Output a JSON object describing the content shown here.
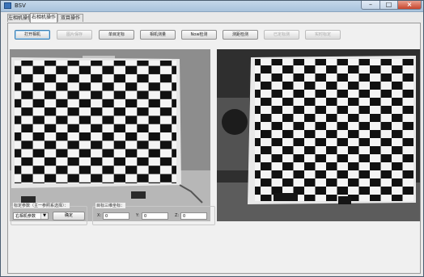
{
  "window": {
    "title": "BSV"
  },
  "window_controls": {
    "minimize": "–",
    "maximize": "□",
    "close": "×"
  },
  "tabs": [
    {
      "label": "左相机操作",
      "active": false
    },
    {
      "label": "右相机操作",
      "active": true
    },
    {
      "label": "双目操作",
      "active": false
    }
  ],
  "toolbar": [
    {
      "label": "打开相机",
      "enabled": true,
      "focused": true
    },
    {
      "label": "图片保存",
      "enabled": false
    },
    {
      "label": "单目定标",
      "enabled": true
    },
    {
      "label": "相机测量",
      "enabled": true
    },
    {
      "label": "Now检测",
      "enabled": true
    },
    {
      "label": "测距检测",
      "enabled": true
    },
    {
      "label": "已定标测",
      "enabled": false
    },
    {
      "label": "实时标定",
      "enabled": false
    }
  ],
  "bottom": {
    "param_group_label": "标定参数（主一参照系选择）：",
    "param_select_value": "右相机参数",
    "confirm_label": "确定",
    "coord_group_label": "目标三维坐标：",
    "coords": [
      {
        "label": "X:",
        "value": "0"
      },
      {
        "label": "Y:",
        "value": "0"
      },
      {
        "label": "Z:",
        "value": "0"
      }
    ]
  },
  "colors": {
    "accent": "#3c7fb1",
    "close": "#c8452c"
  }
}
